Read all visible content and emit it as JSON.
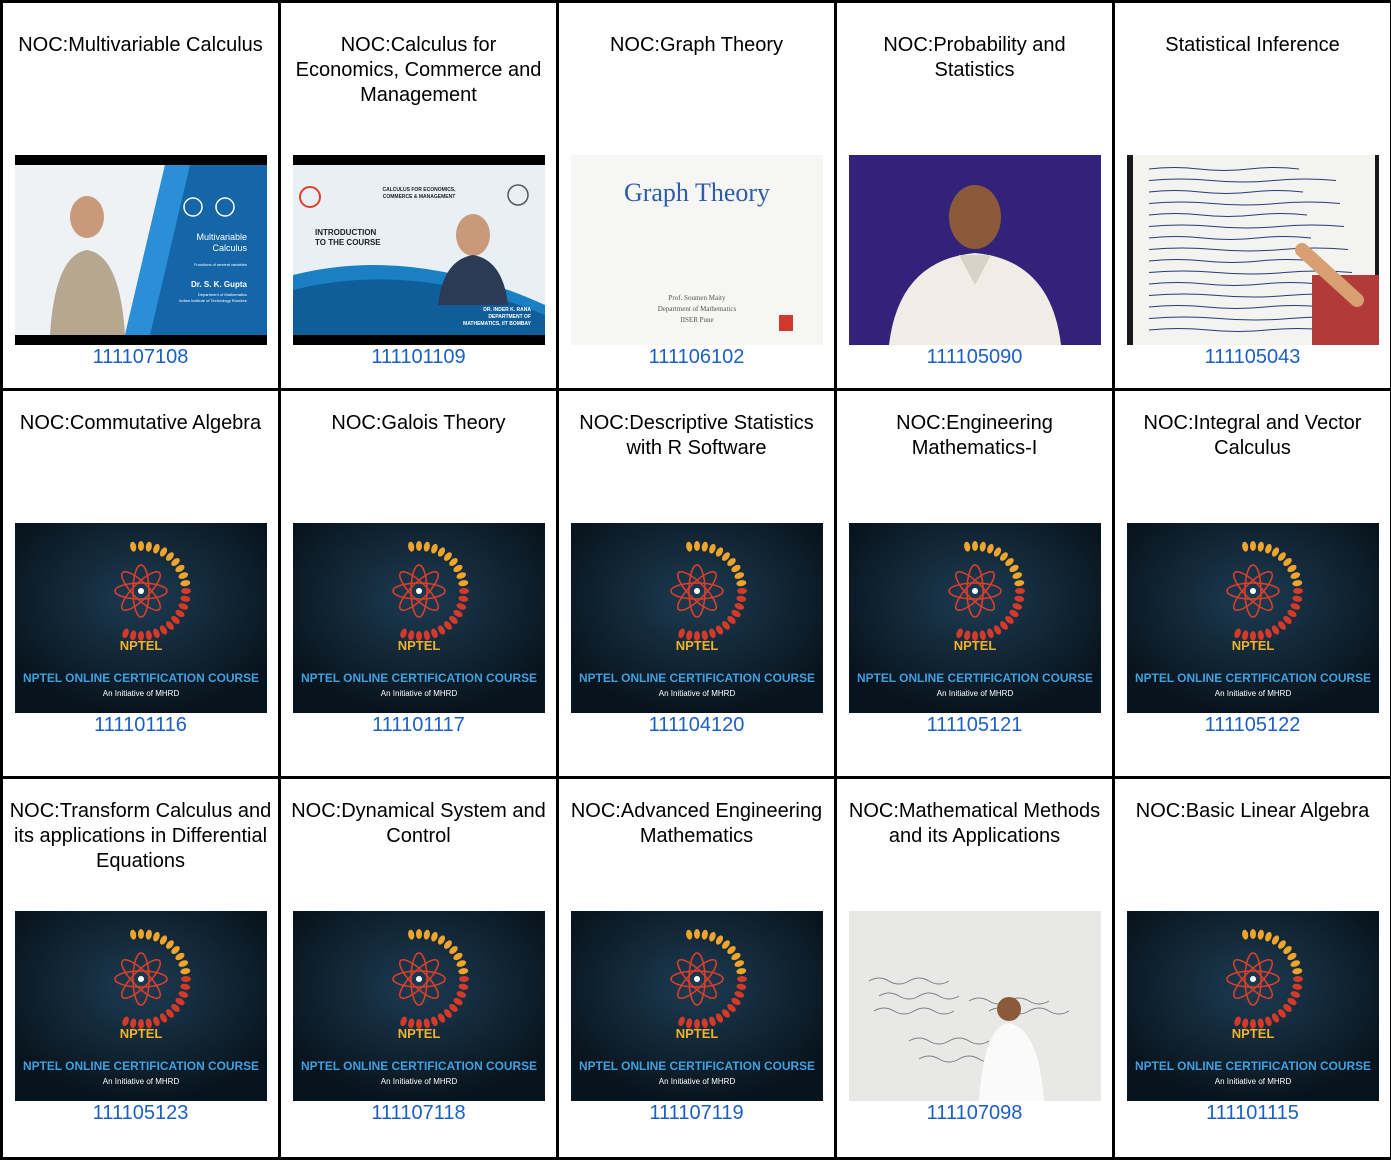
{
  "courses": [
    {
      "title": "NOC:Multivariable Calculus",
      "id": "111107108",
      "thumb": "lecturer-slide",
      "thumb_text": [
        "Multivariable",
        "Calculus",
        "Functions of several variables",
        "Dr. S. K. Gupta",
        "Department of Mathematics",
        "Indian Institute of Technology Roorkee"
      ]
    },
    {
      "title": "NOC:Calculus for Economics, Commerce and Management",
      "id": "111101109",
      "thumb": "intro-slide",
      "thumb_text": [
        "CALCULUS FOR ECONOMICS,",
        "COMMERCE & MANAGEMENT",
        "INTRODUCTION",
        "TO THE COURSE",
        "DR. INDER K. RANA",
        "DEPARTMENT OF",
        "MATHEMATICS, IIT BOMBAY"
      ]
    },
    {
      "title": "NOC:Graph Theory",
      "id": "111106102",
      "thumb": "graph-theory-slide",
      "thumb_text": [
        "Graph Theory",
        "Prof. Soumen Maity",
        "Department of Mathematics",
        "IISER Pune"
      ]
    },
    {
      "title": "NOC:Probability and Statistics",
      "id": "111105090",
      "thumb": "lecturer-video",
      "thumb_text": []
    },
    {
      "title": "Statistical Inference",
      "id": "111105043",
      "thumb": "handwritten-notes",
      "thumb_text": []
    },
    {
      "title": "NOC:Commutative Algebra",
      "id": "111101116",
      "thumb": "nptel",
      "thumb_text": []
    },
    {
      "title": "NOC:Galois Theory",
      "id": "111101117",
      "thumb": "nptel",
      "thumb_text": []
    },
    {
      "title": "NOC:Descriptive Statistics with R Software",
      "id": "111104120",
      "thumb": "nptel",
      "thumb_text": []
    },
    {
      "title": "NOC:Engineering Mathematics-I",
      "id": "111105121",
      "thumb": "nptel",
      "thumb_text": []
    },
    {
      "title": "NOC:Integral and Vector Calculus",
      "id": "111105122",
      "thumb": "nptel",
      "thumb_text": []
    },
    {
      "title": "NOC:Transform Calculus and its applications in Differential Equations",
      "id": "111105123",
      "thumb": "nptel",
      "thumb_text": []
    },
    {
      "title": "NOC:Dynamical System and Control",
      "id": "111107118",
      "thumb": "nptel",
      "thumb_text": []
    },
    {
      "title": "NOC:Advanced Engineering Mathematics",
      "id": "111107119",
      "thumb": "nptel",
      "thumb_text": []
    },
    {
      "title": "NOC:Mathematical Methods and its Applications",
      "id": "111107098",
      "thumb": "whiteboard",
      "thumb_text": []
    },
    {
      "title": "NOC:Basic Linear Algebra",
      "id": "111101115",
      "thumb": "nptel",
      "thumb_text": []
    }
  ],
  "nptel_thumb": {
    "logo_text": "NPTEL",
    "line1": "NPTEL ONLINE CERTIFICATION COURSE",
    "line2": "An Initiative of MHRD"
  },
  "colors": {
    "link": "#1a5fc9",
    "nptel_bg": "#0b1e2c",
    "nptel_accent": "#f0b22a",
    "nptel_line": "#3fa0e0"
  }
}
